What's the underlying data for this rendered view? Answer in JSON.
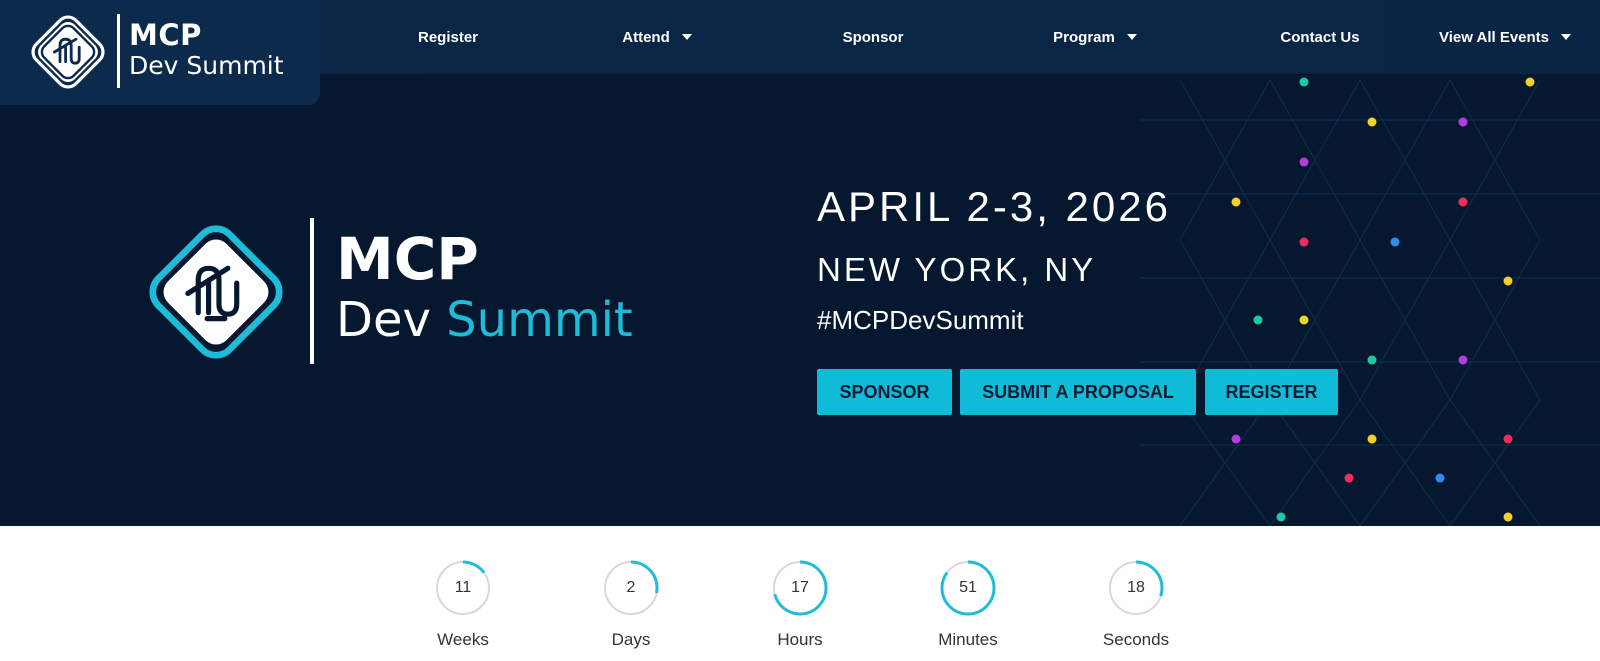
{
  "brand": {
    "mcp": "MCP",
    "dev": "Dev Summit"
  },
  "nav": {
    "items": [
      {
        "label": "Register",
        "dropdown": false
      },
      {
        "label": "Attend",
        "dropdown": true
      },
      {
        "label": "Sponsor",
        "dropdown": false
      },
      {
        "label": "Program",
        "dropdown": true
      },
      {
        "label": "Contact Us",
        "dropdown": false
      },
      {
        "label": "View All Events",
        "dropdown": true
      }
    ]
  },
  "hero": {
    "logo_mcp": "MCP",
    "logo_dev": "Dev",
    "logo_summit": "Summit",
    "date": "APRIL 2-3, 2026",
    "location": "NEW YORK, NY",
    "hashtag": "#MCPDevSummit",
    "buttons": {
      "sponsor": "SPONSOR",
      "proposal": "SUBMIT A PROPOSAL",
      "register": "REGISTER"
    }
  },
  "countdown": {
    "units": [
      {
        "value": "11",
        "label": "Weeks",
        "progress": 0.15
      },
      {
        "value": "2",
        "label": "Days",
        "progress": 0.28
      },
      {
        "value": "17",
        "label": "Hours",
        "progress": 0.71
      },
      {
        "value": "51",
        "label": "Minutes",
        "progress": 0.85
      },
      {
        "value": "18",
        "label": "Seconds",
        "progress": 0.3
      }
    ]
  },
  "colors": {
    "accent": "#1fbcd8",
    "button": "#0fbcd8",
    "hero_bg": "#06182f",
    "nav_bg": "#0a2646",
    "ring_track": "#d8d8d8"
  },
  "icons": {
    "logo": "mcp-paperclip-diamond-logo",
    "dropdown": "caret-down-icon"
  }
}
